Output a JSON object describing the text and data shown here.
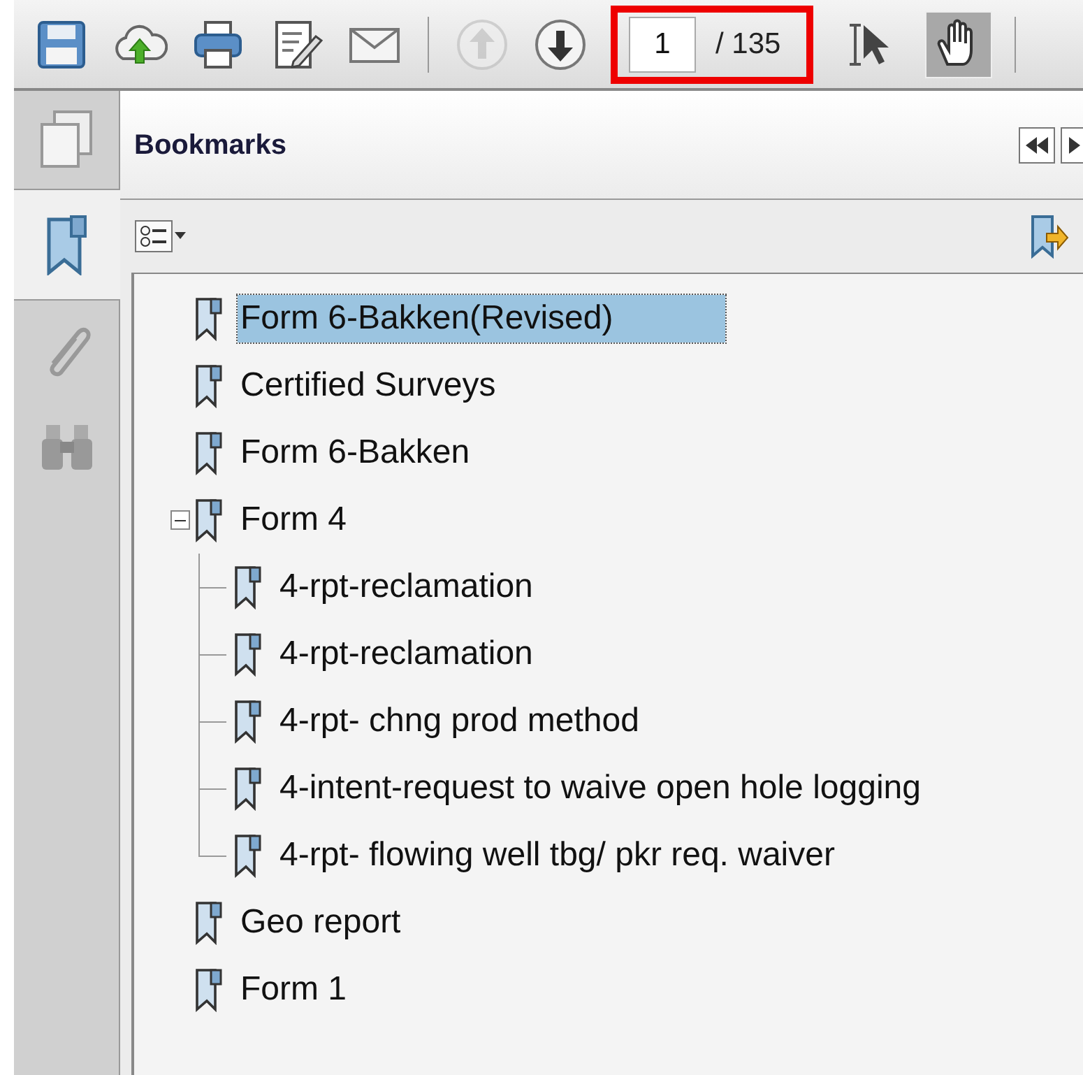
{
  "toolbar": {
    "tools": [
      {
        "kind": "save"
      },
      {
        "kind": "upload"
      },
      {
        "kind": "print"
      },
      {
        "kind": "edit"
      },
      {
        "kind": "email"
      }
    ],
    "nav": [
      {
        "kind": "up",
        "disabled": true
      },
      {
        "kind": "down",
        "disabled": false
      }
    ],
    "page_field": {
      "value": "1",
      "total": "/ 135",
      "highlighted": true
    },
    "modes": [
      {
        "kind": "select",
        "selected": false
      },
      {
        "kind": "hand",
        "selected": true
      }
    ]
  },
  "sidebar_tabs": [
    {
      "kind": "pages",
      "selected": false
    },
    {
      "kind": "bookmarks",
      "selected": true
    },
    {
      "kind": "attachments",
      "selected": false
    },
    {
      "kind": "search",
      "selected": false
    }
  ],
  "panel": {
    "title": "Bookmarks",
    "tree": [
      {
        "label": "Form 6-Bakken(Revised)",
        "selected": true
      },
      {
        "label": "Certified Surveys",
        "selected": false
      },
      {
        "label": "Form 6-Bakken",
        "selected": false
      },
      {
        "label": "Form 4",
        "selected": false,
        "expanded": true,
        "children": [
          {
            "label": "4-rpt-reclamation",
            "selected": false
          },
          {
            "label": "4-rpt-reclamation",
            "selected": false
          },
          {
            "label": "4-rpt- chng prod method",
            "selected": false
          },
          {
            "label": "4-intent-request to waive open hole logging",
            "selected": false
          },
          {
            "label": "4-rpt- flowing well tbg/ pkr req. waiver",
            "selected": false
          }
        ]
      },
      {
        "label": "Geo report",
        "selected": false
      },
      {
        "label": "Form 1",
        "selected": false
      }
    ]
  }
}
